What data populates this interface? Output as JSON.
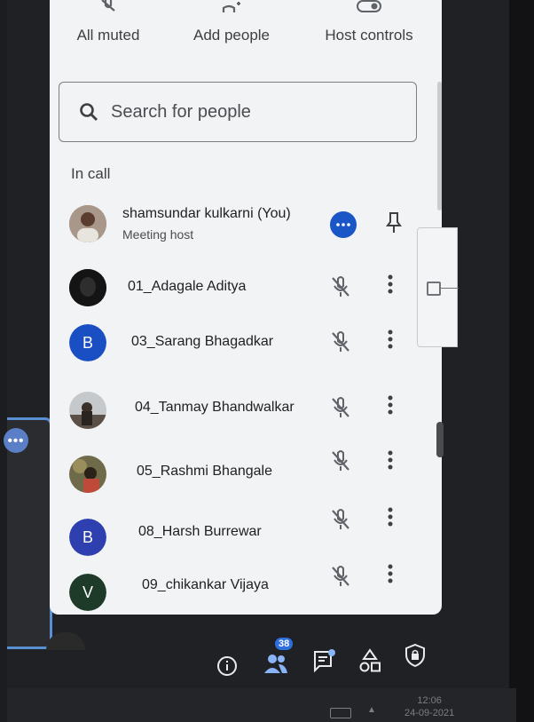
{
  "actions": [
    {
      "label": "All muted",
      "icon": "mic-off-icon"
    },
    {
      "label": "Add people",
      "icon": "person-add-icon"
    },
    {
      "label": "Host controls",
      "icon": "toggle-icon"
    }
  ],
  "search": {
    "placeholder": "Search for people",
    "icon": "search-icon"
  },
  "section_title": "In call",
  "participants": [
    {
      "name": "shamsundar kulkarni (You)",
      "subtitle": "Meeting host",
      "avatar": "photo",
      "action_icon": "more-horiz-icon",
      "secondary_icon": "pin-icon"
    },
    {
      "name": "01_Adagale Aditya",
      "avatar": "photo-dark",
      "muted": true
    },
    {
      "name": "03_Sarang Bhagadkar",
      "avatar_letter": "B",
      "avatar_color": "#1a4fc4",
      "muted": true
    },
    {
      "name": "04_Tanmay Bhandwalkar",
      "avatar": "photo",
      "muted": true
    },
    {
      "name": "05_Rashmi Bhangale",
      "avatar": "photo",
      "muted": true
    },
    {
      "name": "08_Harsh Burrewar",
      "avatar_letter": "B",
      "avatar_color": "#2e3fb0",
      "muted": true
    },
    {
      "name": "09_chikankar Vijaya",
      "avatar_letter": "V",
      "avatar_color": "#1e3a28",
      "muted": true
    }
  ],
  "bottom_bar": {
    "participant_count": "38",
    "icons": [
      "info-icon",
      "people-icon",
      "chat-icon",
      "activities-icon",
      "safety-shield-icon"
    ]
  },
  "taskbar": {
    "time": "12:06",
    "date": "24-09-2021"
  },
  "colors": {
    "accent": "#1a56c6",
    "panel_bg": "#f1f3f4",
    "screen_bg": "#202124"
  }
}
